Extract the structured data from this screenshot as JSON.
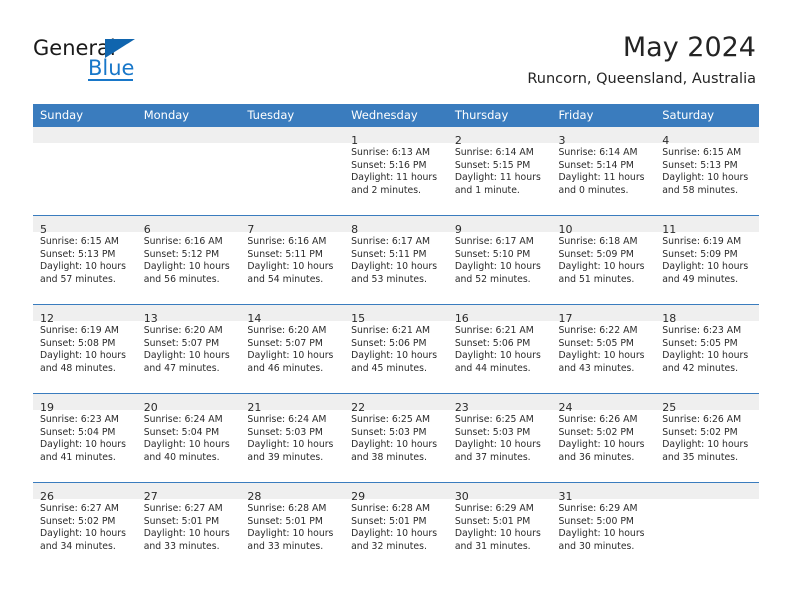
{
  "brand": {
    "name_part1": "General",
    "name_part2": "Blue",
    "accent_color": "#1877c9",
    "triangle_color": "#1065ae"
  },
  "header": {
    "month_title": "May 2024",
    "location": "Runcorn, Queensland, Australia",
    "header_bg_color": "#3a7cbe",
    "daynum_band_color": "#efefef"
  },
  "weekday_headers": [
    "Sunday",
    "Monday",
    "Tuesday",
    "Wednesday",
    "Thursday",
    "Friday",
    "Saturday"
  ],
  "weeks": [
    {
      "days": [
        {
          "num": "",
          "sunrise": "",
          "sunset": "",
          "daylight_line1": "",
          "daylight_line2": "",
          "empty": true
        },
        {
          "num": "",
          "sunrise": "",
          "sunset": "",
          "daylight_line1": "",
          "daylight_line2": "",
          "empty": true
        },
        {
          "num": "",
          "sunrise": "",
          "sunset": "",
          "daylight_line1": "",
          "daylight_line2": "",
          "empty": true
        },
        {
          "num": "1",
          "sunrise": "Sunrise: 6:13 AM",
          "sunset": "Sunset: 5:16 PM",
          "daylight_line1": "Daylight: 11 hours",
          "daylight_line2": "and 2 minutes.",
          "empty": false
        },
        {
          "num": "2",
          "sunrise": "Sunrise: 6:14 AM",
          "sunset": "Sunset: 5:15 PM",
          "daylight_line1": "Daylight: 11 hours",
          "daylight_line2": "and 1 minute.",
          "empty": false
        },
        {
          "num": "3",
          "sunrise": "Sunrise: 6:14 AM",
          "sunset": "Sunset: 5:14 PM",
          "daylight_line1": "Daylight: 11 hours",
          "daylight_line2": "and 0 minutes.",
          "empty": false
        },
        {
          "num": "4",
          "sunrise": "Sunrise: 6:15 AM",
          "sunset": "Sunset: 5:13 PM",
          "daylight_line1": "Daylight: 10 hours",
          "daylight_line2": "and 58 minutes.",
          "empty": false
        }
      ]
    },
    {
      "days": [
        {
          "num": "5",
          "sunrise": "Sunrise: 6:15 AM",
          "sunset": "Sunset: 5:13 PM",
          "daylight_line1": "Daylight: 10 hours",
          "daylight_line2": "and 57 minutes.",
          "empty": false
        },
        {
          "num": "6",
          "sunrise": "Sunrise: 6:16 AM",
          "sunset": "Sunset: 5:12 PM",
          "daylight_line1": "Daylight: 10 hours",
          "daylight_line2": "and 56 minutes.",
          "empty": false
        },
        {
          "num": "7",
          "sunrise": "Sunrise: 6:16 AM",
          "sunset": "Sunset: 5:11 PM",
          "daylight_line1": "Daylight: 10 hours",
          "daylight_line2": "and 54 minutes.",
          "empty": false
        },
        {
          "num": "8",
          "sunrise": "Sunrise: 6:17 AM",
          "sunset": "Sunset: 5:11 PM",
          "daylight_line1": "Daylight: 10 hours",
          "daylight_line2": "and 53 minutes.",
          "empty": false
        },
        {
          "num": "9",
          "sunrise": "Sunrise: 6:17 AM",
          "sunset": "Sunset: 5:10 PM",
          "daylight_line1": "Daylight: 10 hours",
          "daylight_line2": "and 52 minutes.",
          "empty": false
        },
        {
          "num": "10",
          "sunrise": "Sunrise: 6:18 AM",
          "sunset": "Sunset: 5:09 PM",
          "daylight_line1": "Daylight: 10 hours",
          "daylight_line2": "and 51 minutes.",
          "empty": false
        },
        {
          "num": "11",
          "sunrise": "Sunrise: 6:19 AM",
          "sunset": "Sunset: 5:09 PM",
          "daylight_line1": "Daylight: 10 hours",
          "daylight_line2": "and 49 minutes.",
          "empty": false
        }
      ]
    },
    {
      "days": [
        {
          "num": "12",
          "sunrise": "Sunrise: 6:19 AM",
          "sunset": "Sunset: 5:08 PM",
          "daylight_line1": "Daylight: 10 hours",
          "daylight_line2": "and 48 minutes.",
          "empty": false
        },
        {
          "num": "13",
          "sunrise": "Sunrise: 6:20 AM",
          "sunset": "Sunset: 5:07 PM",
          "daylight_line1": "Daylight: 10 hours",
          "daylight_line2": "and 47 minutes.",
          "empty": false
        },
        {
          "num": "14",
          "sunrise": "Sunrise: 6:20 AM",
          "sunset": "Sunset: 5:07 PM",
          "daylight_line1": "Daylight: 10 hours",
          "daylight_line2": "and 46 minutes.",
          "empty": false
        },
        {
          "num": "15",
          "sunrise": "Sunrise: 6:21 AM",
          "sunset": "Sunset: 5:06 PM",
          "daylight_line1": "Daylight: 10 hours",
          "daylight_line2": "and 45 minutes.",
          "empty": false
        },
        {
          "num": "16",
          "sunrise": "Sunrise: 6:21 AM",
          "sunset": "Sunset: 5:06 PM",
          "daylight_line1": "Daylight: 10 hours",
          "daylight_line2": "and 44 minutes.",
          "empty": false
        },
        {
          "num": "17",
          "sunrise": "Sunrise: 6:22 AM",
          "sunset": "Sunset: 5:05 PM",
          "daylight_line1": "Daylight: 10 hours",
          "daylight_line2": "and 43 minutes.",
          "empty": false
        },
        {
          "num": "18",
          "sunrise": "Sunrise: 6:23 AM",
          "sunset": "Sunset: 5:05 PM",
          "daylight_line1": "Daylight: 10 hours",
          "daylight_line2": "and 42 minutes.",
          "empty": false
        }
      ]
    },
    {
      "days": [
        {
          "num": "19",
          "sunrise": "Sunrise: 6:23 AM",
          "sunset": "Sunset: 5:04 PM",
          "daylight_line1": "Daylight: 10 hours",
          "daylight_line2": "and 41 minutes.",
          "empty": false
        },
        {
          "num": "20",
          "sunrise": "Sunrise: 6:24 AM",
          "sunset": "Sunset: 5:04 PM",
          "daylight_line1": "Daylight: 10 hours",
          "daylight_line2": "and 40 minutes.",
          "empty": false
        },
        {
          "num": "21",
          "sunrise": "Sunrise: 6:24 AM",
          "sunset": "Sunset: 5:03 PM",
          "daylight_line1": "Daylight: 10 hours",
          "daylight_line2": "and 39 minutes.",
          "empty": false
        },
        {
          "num": "22",
          "sunrise": "Sunrise: 6:25 AM",
          "sunset": "Sunset: 5:03 PM",
          "daylight_line1": "Daylight: 10 hours",
          "daylight_line2": "and 38 minutes.",
          "empty": false
        },
        {
          "num": "23",
          "sunrise": "Sunrise: 6:25 AM",
          "sunset": "Sunset: 5:03 PM",
          "daylight_line1": "Daylight: 10 hours",
          "daylight_line2": "and 37 minutes.",
          "empty": false
        },
        {
          "num": "24",
          "sunrise": "Sunrise: 6:26 AM",
          "sunset": "Sunset: 5:02 PM",
          "daylight_line1": "Daylight: 10 hours",
          "daylight_line2": "and 36 minutes.",
          "empty": false
        },
        {
          "num": "25",
          "sunrise": "Sunrise: 6:26 AM",
          "sunset": "Sunset: 5:02 PM",
          "daylight_line1": "Daylight: 10 hours",
          "daylight_line2": "and 35 minutes.",
          "empty": false
        }
      ]
    },
    {
      "days": [
        {
          "num": "26",
          "sunrise": "Sunrise: 6:27 AM",
          "sunset": "Sunset: 5:02 PM",
          "daylight_line1": "Daylight: 10 hours",
          "daylight_line2": "and 34 minutes.",
          "empty": false
        },
        {
          "num": "27",
          "sunrise": "Sunrise: 6:27 AM",
          "sunset": "Sunset: 5:01 PM",
          "daylight_line1": "Daylight: 10 hours",
          "daylight_line2": "and 33 minutes.",
          "empty": false
        },
        {
          "num": "28",
          "sunrise": "Sunrise: 6:28 AM",
          "sunset": "Sunset: 5:01 PM",
          "daylight_line1": "Daylight: 10 hours",
          "daylight_line2": "and 33 minutes.",
          "empty": false
        },
        {
          "num": "29",
          "sunrise": "Sunrise: 6:28 AM",
          "sunset": "Sunset: 5:01 PM",
          "daylight_line1": "Daylight: 10 hours",
          "daylight_line2": "and 32 minutes.",
          "empty": false
        },
        {
          "num": "30",
          "sunrise": "Sunrise: 6:29 AM",
          "sunset": "Sunset: 5:01 PM",
          "daylight_line1": "Daylight: 10 hours",
          "daylight_line2": "and 31 minutes.",
          "empty": false
        },
        {
          "num": "31",
          "sunrise": "Sunrise: 6:29 AM",
          "sunset": "Sunset: 5:00 PM",
          "daylight_line1": "Daylight: 10 hours",
          "daylight_line2": "and 30 minutes.",
          "empty": false
        },
        {
          "num": "",
          "sunrise": "",
          "sunset": "",
          "daylight_line1": "",
          "daylight_line2": "",
          "empty": true
        }
      ]
    }
  ]
}
